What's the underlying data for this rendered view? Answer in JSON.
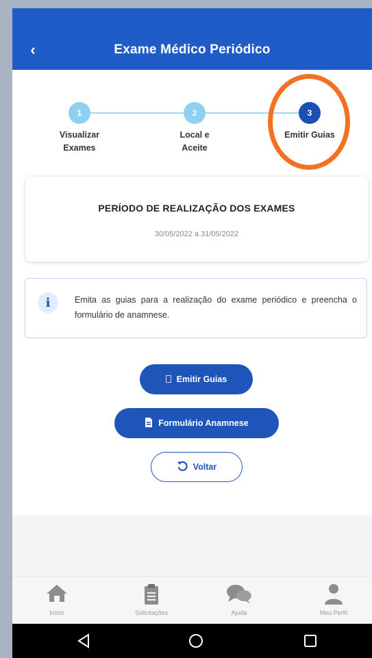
{
  "appbar": {
    "back_icon": "chevron-left-icon",
    "title": "Exame Médico Periódico"
  },
  "stepper": {
    "steps": [
      {
        "number": "1",
        "label_line1": "Visualizar",
        "label_line2": "Exames",
        "state": "done"
      },
      {
        "number": "2",
        "label_line1": "Local e",
        "label_line2": "Aceite",
        "state": "done"
      },
      {
        "number": "3",
        "label_line1": "Emitir Guias",
        "label_line2": "",
        "state": "active"
      }
    ],
    "colors": {
      "done": "#8fd0f0",
      "active": "#1b4fb3",
      "line": "#9fd6ef"
    },
    "annotation_color": "#f37121"
  },
  "period_card": {
    "title": "PERÍODO DE REALIZAÇÃO DOS EXAMES",
    "dates": "30/05/2022 a 31/05/2022"
  },
  "info_box": {
    "icon": "info-icon",
    "text": "Emita as guias para a realização do exame periódico e preencha o formulário de anamnese."
  },
  "actions": {
    "emit_label": "Emitir Guias",
    "emit_icon": "document-icon",
    "anamnese_label": "Formulário Anamnese",
    "anamnese_icon": "form-icon",
    "back_label": "Voltar",
    "back_icon": "undo-icon"
  },
  "tabbar": {
    "items": [
      {
        "label": "Início",
        "icon": "home-icon"
      },
      {
        "label": "Solicitações",
        "icon": "clipboard-icon"
      },
      {
        "label": "Ajuda",
        "icon": "chat-icon"
      },
      {
        "label": "Meu Perfil",
        "icon": "user-icon"
      }
    ]
  },
  "system_nav": {
    "back": "back-triangle-icon",
    "home": "home-circle-icon",
    "recents": "recents-square-icon"
  },
  "colors": {
    "primary": "#1f5cc7",
    "button": "#1f55b9"
  }
}
